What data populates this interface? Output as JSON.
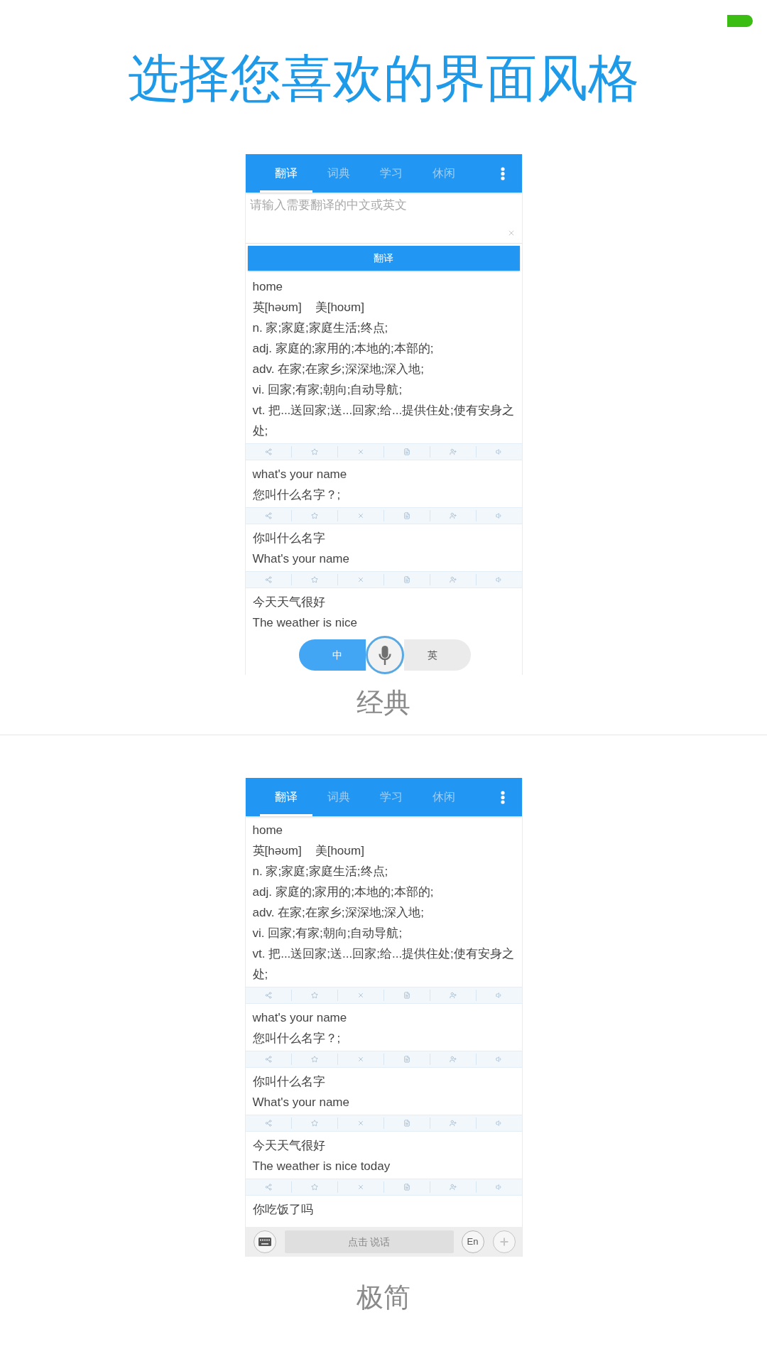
{
  "headline": "选择您喜欢的界面风格",
  "styles": [
    {
      "kind": "classic",
      "tabs": [
        {
          "label": "翻译",
          "selected": true
        },
        {
          "label": "词典",
          "selected": false
        },
        {
          "label": "学习",
          "selected": false
        },
        {
          "label": "休闲",
          "selected": false
        }
      ],
      "input": {
        "placeholder": "请输入需要翻译的中文或英文"
      },
      "translate_button": "翻译",
      "results": [
        {
          "kind": "word",
          "word": "home",
          "phonetics": [
            "英[həʊm]",
            "美[hoʊm]"
          ],
          "definitions": [
            "n. 家;家庭;家庭生活;终点;",
            "adj. 家庭的;家用的;本地的;本部的;",
            "adv. 在家;在家乡;深深地;深入地;",
            "vi. 回家;有家;朝向;自动导航;",
            "vt. 把...送回家;送...回家;给...提供住处;使有安身之处;"
          ]
        },
        {
          "kind": "sentence",
          "source": "what's your name",
          "translation": "您叫什么名字？;"
        },
        {
          "kind": "sentence",
          "source": "你叫什么名字",
          "translation": "What's your name"
        },
        {
          "kind": "sentence",
          "source": "今天天气很好",
          "translation": "The weather is nice"
        }
      ],
      "voice_toggle": [
        {
          "label": "中",
          "selected": true
        },
        {
          "label": "英",
          "selected": false
        }
      ],
      "caption": "经典"
    },
    {
      "kind": "minimal",
      "tabs": [
        {
          "label": "翻译",
          "selected": true
        },
        {
          "label": "词典",
          "selected": false
        },
        {
          "label": "学习",
          "selected": false
        },
        {
          "label": "休闲",
          "selected": false
        }
      ],
      "results": [
        {
          "kind": "word",
          "word": "home",
          "phonetics": [
            "英[həʊm]",
            "美[hoʊm]"
          ],
          "definitions": [
            "n. 家;家庭;家庭生活;终点;",
            "adj. 家庭的;家用的;本地的;本部的;",
            "adv. 在家;在家乡;深深地;深入地;",
            "vi. 回家;有家;朝向;自动导航;",
            "vt. 把...送回家;送...回家;给...提供住处;使有安身之处;"
          ]
        },
        {
          "kind": "sentence",
          "source": "what's your name",
          "translation": "您叫什么名字？;"
        },
        {
          "kind": "sentence",
          "source": "你叫什么名字",
          "translation": "What's your name"
        },
        {
          "kind": "sentence",
          "source": "今天天气很好",
          "translation": "The weather is nice today"
        },
        {
          "kind": "sentence",
          "source": "你吃饭了吗"
        }
      ],
      "bottom_bar": {
        "talk_button": "点击 说话",
        "language_button": "En"
      },
      "caption": "极简"
    }
  ]
}
